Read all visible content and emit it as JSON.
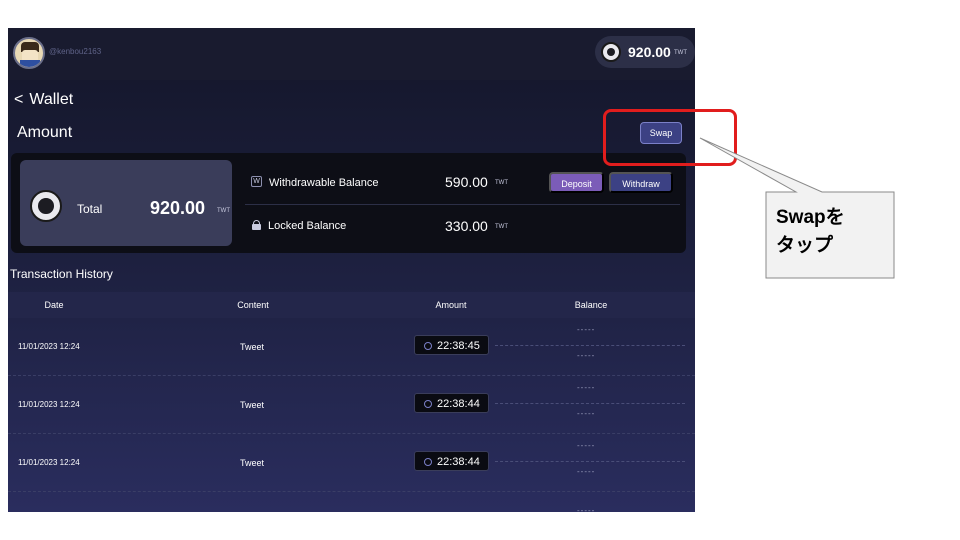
{
  "header": {
    "username": "@kenbou2163",
    "balance_amount": "920.00",
    "balance_unit": "TWT"
  },
  "page": {
    "back_chevron": "<",
    "title": "Wallet",
    "section_title": "Amount",
    "swap_label": "Swap"
  },
  "balance_card": {
    "total_label": "Total",
    "total_amount": "920.00",
    "total_unit": "TWT",
    "withdrawable_icon": "W",
    "withdrawable_label": "Withdrawable Balance",
    "withdrawable_amount": "590.00",
    "withdrawable_unit": "TWT",
    "deposit_label": "Deposit",
    "withdraw_label": "Withdraw",
    "locked_label": "Locked Balance",
    "locked_amount": "330.00",
    "locked_unit": "TWT"
  },
  "transactions": {
    "title": "Transaction History",
    "columns": [
      "Date",
      "Content",
      "Amount",
      "Balance"
    ],
    "rows": [
      {
        "date": "11/01/2023 12:24",
        "content": "Tweet",
        "time": "22:38:45",
        "balance_top": "-----",
        "balance_bottom": "-----"
      },
      {
        "date": "11/01/2023 12:24",
        "content": "Tweet",
        "time": "22:38:44",
        "balance_top": "-----",
        "balance_bottom": "-----"
      },
      {
        "date": "11/01/2023 12:24",
        "content": "Tweet",
        "time": "22:38:44",
        "balance_top": "-----",
        "balance_bottom": "-----"
      }
    ],
    "trailing_balance": "-----"
  },
  "annotation": {
    "callout_text": "Swapを\nタップ",
    "highlight_color": "#e11d1d"
  },
  "icons": {
    "avatar": "avatar-icon",
    "coin": "twt-coin-icon",
    "withdrawable": "wallet-w-icon",
    "locked": "lock-icon",
    "clock": "clock-icon"
  },
  "colors": {
    "deposit": "#7b5cb8",
    "withdraw": "#3c4184",
    "swap": "#3c4184",
    "background_top": "#14162a",
    "background_bottom": "#2a2d5e"
  }
}
